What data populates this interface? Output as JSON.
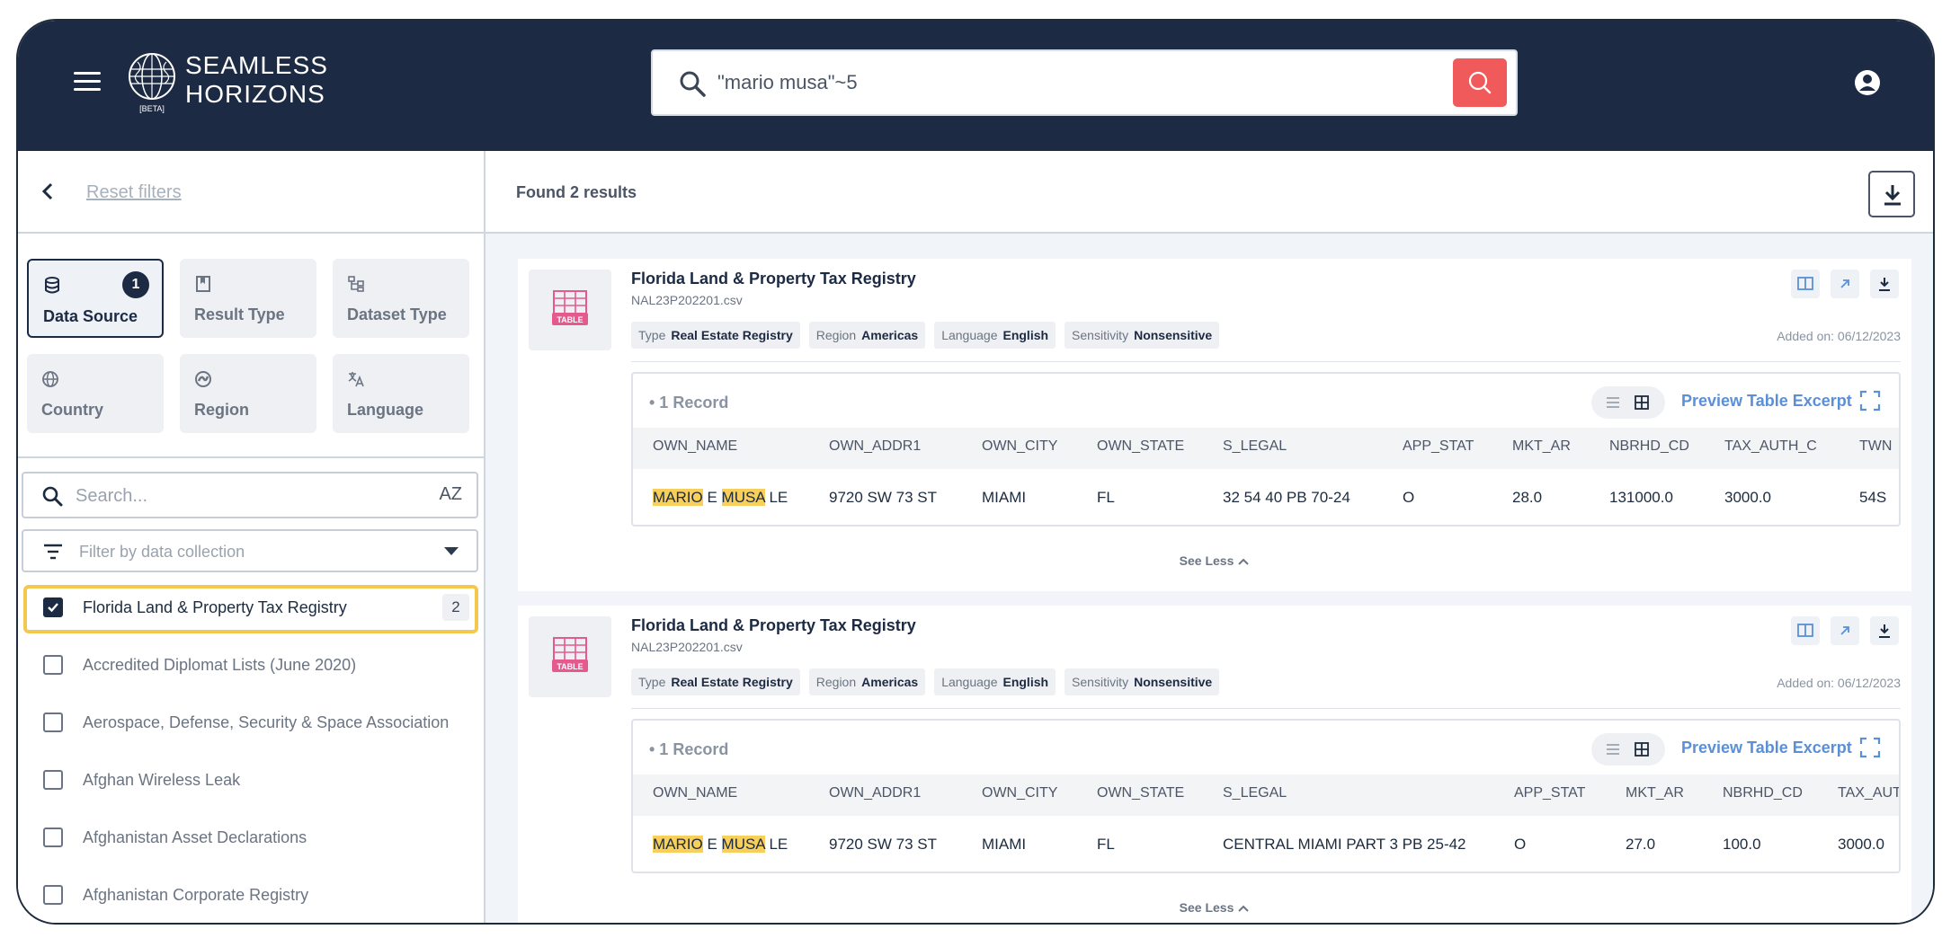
{
  "header": {
    "brand_line1": "SEAMLESS",
    "brand_line2": "HORIZONS",
    "brand_beta": "[BETA]",
    "search_value": "\"mario musa\"~5"
  },
  "sidebar": {
    "reset_label": "Reset filters",
    "tiles": [
      {
        "label": "Data Source",
        "icon": "database-icon",
        "badge": "1",
        "active": true
      },
      {
        "label": "Result Type",
        "icon": "bookmark-icon"
      },
      {
        "label": "Dataset Type",
        "icon": "hierarchy-icon"
      },
      {
        "label": "Country",
        "icon": "globe-icon"
      },
      {
        "label": "Region",
        "icon": "region-icon"
      },
      {
        "label": "Language",
        "icon": "translate-icon"
      }
    ],
    "search_placeholder": "Search...",
    "sort_label": "AZ",
    "filter_placeholder": "Filter by data collection",
    "collections": [
      {
        "label": "Florida Land & Property Tax Registry",
        "count": "2",
        "checked": true
      },
      {
        "label": "Accredited Diplomat Lists (June 2020)"
      },
      {
        "label": "Aerospace, Defense, Security & Space Association"
      },
      {
        "label": "Afghan Wireless Leak"
      },
      {
        "label": "Afghanistan Asset Declarations"
      },
      {
        "label": "Afghanistan Corporate Registry"
      }
    ]
  },
  "main": {
    "found_label": "Found 2 results",
    "results": [
      {
        "title": "Florida Land & Property Tax Registry",
        "file": "NAL23P202201.csv",
        "thumb_label": "TABLE",
        "tags": [
          {
            "key": "Type",
            "value": "Real Estate Registry"
          },
          {
            "key": "Region",
            "value": "Americas"
          },
          {
            "key": "Language",
            "value": "English"
          },
          {
            "key": "Sensitivity",
            "value": "Nonsensitive"
          }
        ],
        "added": "Added on: 06/12/2023",
        "record_count": "• 1 Record",
        "preview_label": "Preview Table Excerpt",
        "columns": [
          "OWN_NAME",
          "OWN_ADDR1",
          "OWN_CITY",
          "OWN_STATE",
          "S_LEGAL",
          "APP_STAT",
          "MKT_AR",
          "NBRHD_CD",
          "TAX_AUTH_C",
          "TWN"
        ],
        "row": {
          "name_hl1": "MARIO",
          "name_mid": " E ",
          "name_hl2": "MUSA",
          "name_end": " LE",
          "addr": "9720 SW 73 ST",
          "city": "MIAMI",
          "state": "FL",
          "legal": "32 54 40 PB 70-24",
          "app": "O",
          "mkt": "28.0",
          "nbrhd": "131000.0",
          "tax": "3000.0",
          "twn": "54S"
        },
        "see_less": "See Less"
      },
      {
        "title": "Florida Land & Property Tax Registry",
        "file": "NAL23P202201.csv",
        "thumb_label": "TABLE",
        "tags": [
          {
            "key": "Type",
            "value": "Real Estate Registry"
          },
          {
            "key": "Region",
            "value": "Americas"
          },
          {
            "key": "Language",
            "value": "English"
          },
          {
            "key": "Sensitivity",
            "value": "Nonsensitive"
          }
        ],
        "added": "Added on: 06/12/2023",
        "record_count": "• 1 Record",
        "preview_label": "Preview Table Excerpt",
        "columns": [
          "OWN_NAME",
          "OWN_ADDR1",
          "OWN_CITY",
          "OWN_STATE",
          "S_LEGAL",
          "APP_STAT",
          "MKT_AR",
          "NBRHD_CD",
          "TAX_AUT"
        ],
        "row": {
          "name_hl1": "MARIO",
          "name_mid": " E ",
          "name_hl2": "MUSA",
          "name_end": " LE",
          "addr": "9720 SW 73 ST",
          "city": "MIAMI",
          "state": "FL",
          "legal": "CENTRAL MIAMI PART 3 PB 25-42",
          "app": "O",
          "mkt": "27.0",
          "nbrhd": "100.0",
          "tax": "3000.0"
        },
        "see_less": "See Less"
      }
    ]
  }
}
